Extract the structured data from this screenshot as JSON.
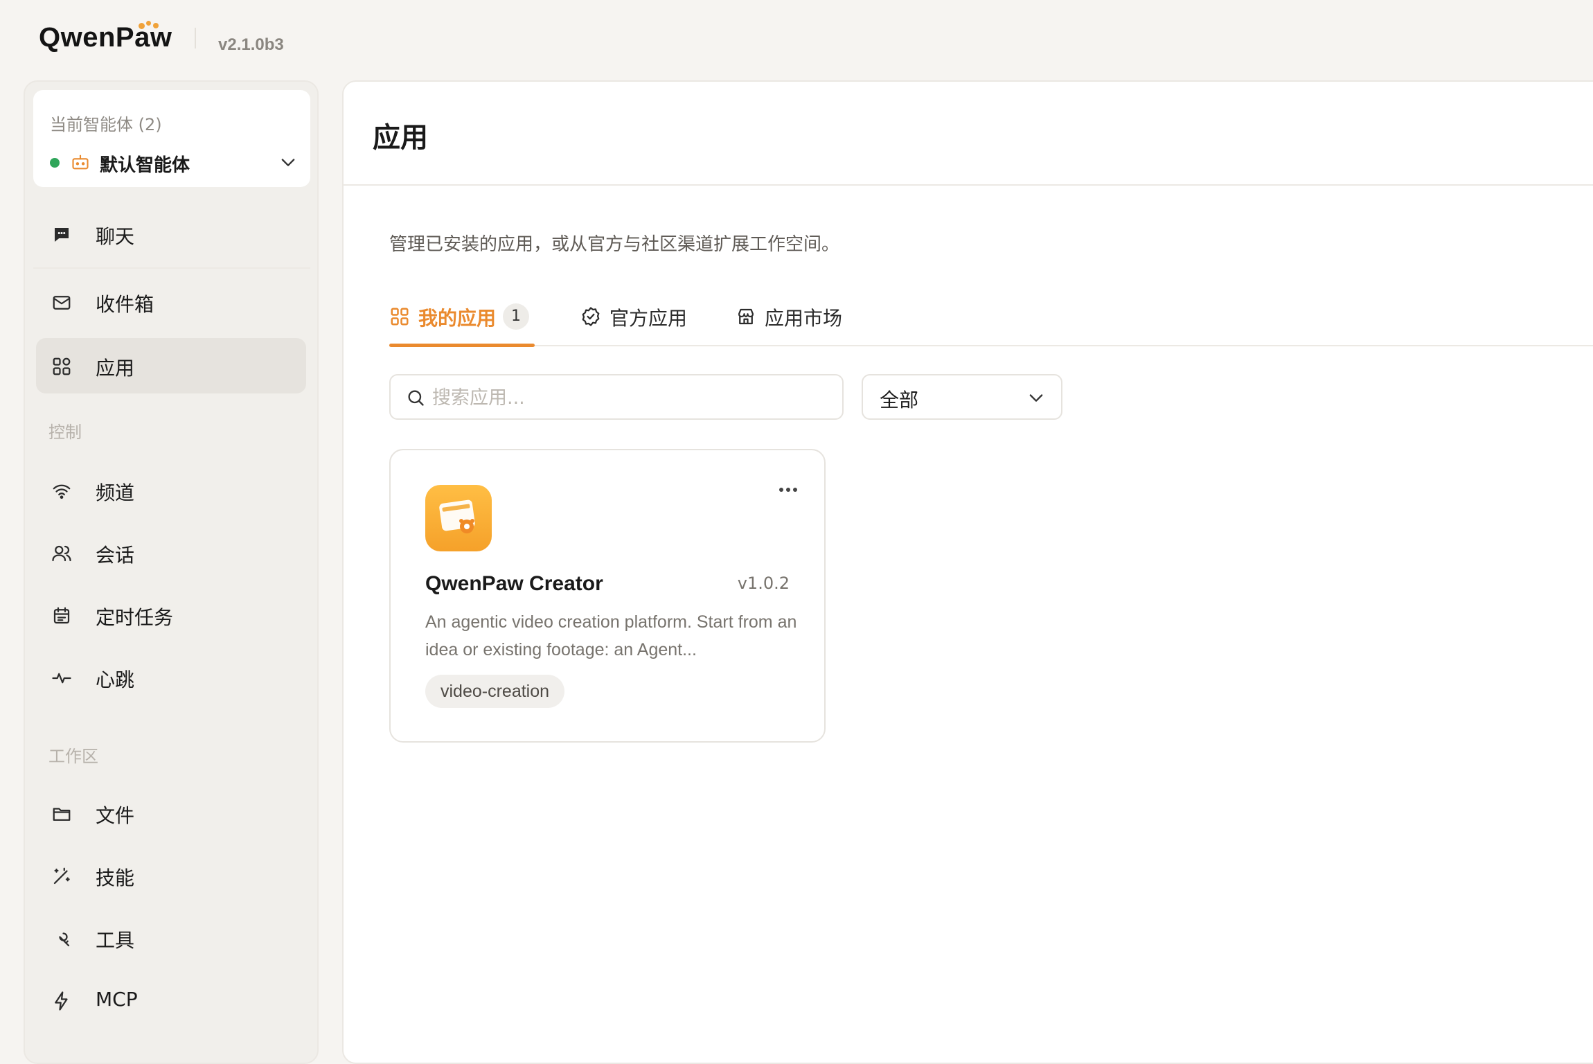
{
  "header": {
    "logo_text": "QwenPaw",
    "version": "v2.1.0b3"
  },
  "sidebar": {
    "agent": {
      "title": "当前智能体 (2)",
      "name": "默认智能体",
      "status_color": "#2fa55a"
    },
    "items_top": [
      {
        "label": "聊天",
        "icon": "chat-icon"
      },
      {
        "label": "收件箱",
        "icon": "mail-icon"
      },
      {
        "label": "应用",
        "icon": "apps-icon",
        "active": true
      }
    ],
    "sections": [
      {
        "title": "控制",
        "items": [
          {
            "label": "频道",
            "icon": "wifi-icon"
          },
          {
            "label": "会话",
            "icon": "users-icon"
          },
          {
            "label": "定时任务",
            "icon": "calendar-icon"
          },
          {
            "label": "心跳",
            "icon": "pulse-icon"
          }
        ]
      },
      {
        "title": "工作区",
        "items": [
          {
            "label": "文件",
            "icon": "folder-icon"
          },
          {
            "label": "技能",
            "icon": "magic-wand-icon"
          },
          {
            "label": "工具",
            "icon": "wrench-icon"
          },
          {
            "label": "MCP",
            "icon": "lightning-icon"
          }
        ]
      }
    ]
  },
  "main": {
    "title": "应用",
    "subtitle": "管理已安装的应用，或从官方与社区渠道扩展工作空间。",
    "tabs": [
      {
        "label": "我的应用",
        "count": "1",
        "icon": "grid-icon",
        "active": true
      },
      {
        "label": "官方应用",
        "icon": "verified-icon"
      },
      {
        "label": "应用市场",
        "icon": "store-icon"
      }
    ],
    "search": {
      "placeholder": "搜索应用...",
      "value": ""
    },
    "filter": {
      "selected": "全部"
    },
    "apps": [
      {
        "name": "QwenPaw Creator",
        "version": "v1.0.2",
        "description": "An agentic video creation platform. Start from an idea or existing footage: an Agent...",
        "tags": [
          "video-creation"
        ],
        "icon": "app-creator-icon"
      }
    ],
    "accent_color": "#ea8a2e"
  }
}
